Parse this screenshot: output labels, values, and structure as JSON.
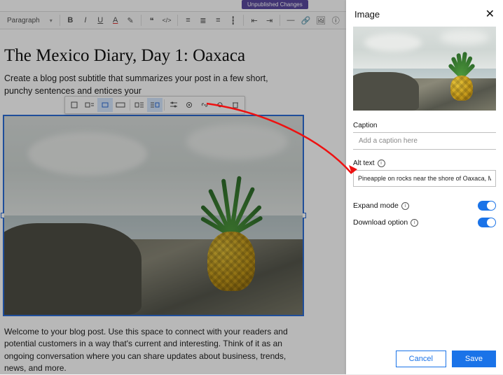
{
  "topbar": {
    "unpublished_label": "Unpublished Changes"
  },
  "toolbar": {
    "style_select": "Paragraph",
    "icons": [
      "B",
      "I",
      "U",
      "A",
      "✎",
      "❝",
      "</>",
      "≡",
      "≣",
      "≡",
      "┇",
      "≡",
      "⇤",
      "⇥",
      "—",
      "🔗",
      "🖼",
      "ⓘ"
    ]
  },
  "post": {
    "title": "The Mexico Diary, Day 1: Oaxaca",
    "subtitle": "Create a blog post subtitle that summarizes your post in a few short, punchy sentences and entices your",
    "body": "Welcome to your blog post. Use this space to connect with your readers and potential customers in a way that's current and interesting. Think of it as an ongoing conversation where you can share updates about business, trends, news, and more."
  },
  "image_toolbar": {
    "icons": [
      "align-none",
      "align-left",
      "align-center-active",
      "align-full",
      "sep",
      "float-left",
      "float-right",
      "sep",
      "settings",
      "gear",
      "link",
      "reset",
      "delete"
    ]
  },
  "panel": {
    "title": "Image",
    "caption_label": "Caption",
    "caption_placeholder": "Add a caption here",
    "alt_label": "Alt text",
    "alt_value": "Pineapple on rocks near the shore of Oaxaca, Mexico",
    "expand_label": "Expand mode",
    "download_label": "Download option",
    "expand_on": true,
    "download_on": true,
    "cancel": "Cancel",
    "save": "Save"
  }
}
